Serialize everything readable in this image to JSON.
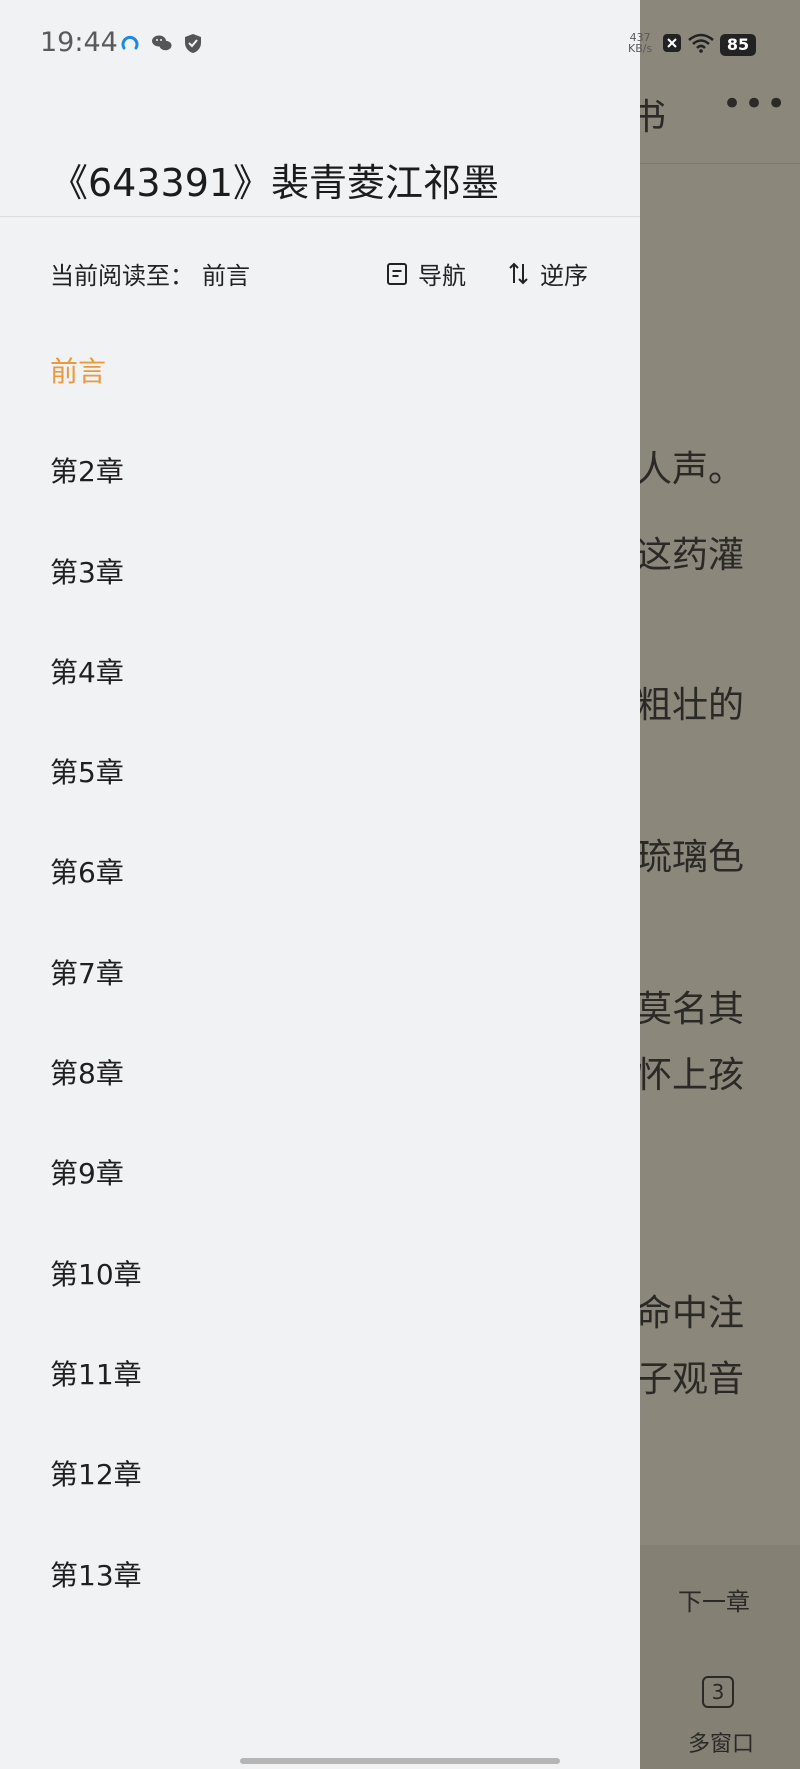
{
  "status_bar": {
    "time": "19:44",
    "net_speed_value": "437",
    "net_speed_unit": "KB/s",
    "battery": "85"
  },
  "drawer": {
    "book_title": "《643391》裴青菱江祁墨",
    "progress_label": "当前阅读至：",
    "progress_value": "前言",
    "nav_label": "导航",
    "order_label": "逆序",
    "chapters": [
      "前言",
      "第2章",
      "第3章",
      "第4章",
      "第5章",
      "第6章",
      "第7章",
      "第8章",
      "第9章",
      "第10章",
      "第11章",
      "第12章",
      "第13章"
    ],
    "current_chapter_index": 0,
    "accent_color": "#e89a3c"
  },
  "reader": {
    "top_title": "书",
    "text_lines": [
      "人声。",
      "这药灌",
      "粗壮的",
      "琉璃色",
      "莫名其",
      "怀上孩",
      "命中注",
      "子观音"
    ],
    "next_chapter_label": "下一章",
    "windows_count": "3",
    "windows_label": "多窗口"
  }
}
